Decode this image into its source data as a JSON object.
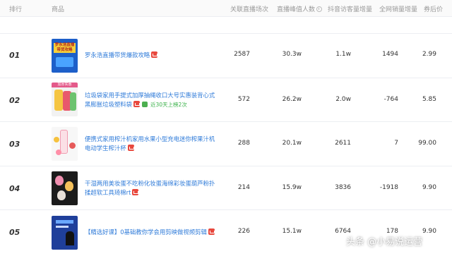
{
  "header": {
    "rank": "排行",
    "product": "商品",
    "live_count": "关联直播场次",
    "peak_viewers": "直播峰值人数",
    "visitor_growth": "抖音访客量增量",
    "sales_growth": "全网销量增量",
    "price_after_coupon": "券后价"
  },
  "rows": [
    {
      "rank": "01",
      "title": "罗永浩直播带货爆款攻略",
      "tag": "",
      "live_count": "2587",
      "peak_viewers": "30.3w",
      "visitor_growth": "1.1w",
      "sales_growth": "1494",
      "price": "2.99"
    },
    {
      "rank": "02",
      "title": "垃圾袋家用手提式加厚抽绳收口大号实惠装背心式黑膨胀垃圾塑料袋",
      "tag": "近30天上榜2次",
      "live_count": "572",
      "peak_viewers": "26.2w",
      "visitor_growth": "2.0w",
      "sales_growth": "-764",
      "price": "5.85"
    },
    {
      "rank": "03",
      "title": "便携式家用榨汁机家用水果小型充电迷你榨果汁机电动学生榨汁杯",
      "tag": "",
      "live_count": "288",
      "peak_viewers": "20.1w",
      "visitor_growth": "2611",
      "sales_growth": "7",
      "price": "99.00"
    },
    {
      "rank": "04",
      "title": "干湿两用美妆蛋不吃粉化妆蛋海绵彩妆蛋葫芦粉扑揉超软工具琦棉rt",
      "tag": "",
      "live_count": "214",
      "peak_viewers": "15.9w",
      "visitor_growth": "3836",
      "sales_growth": "-1918",
      "price": "9.90"
    },
    {
      "rank": "05",
      "title": "【精选好课】0基础教你学会用剪映做视频剪辑",
      "tag": "",
      "live_count": "226",
      "peak_viewers": "15.1w",
      "visitor_growth": "6764",
      "sales_growth": "178",
      "price": "9.90"
    }
  ],
  "thumbs": [
    {
      "icon": "course-cover-image",
      "text": "罗永浩直播带货攻略",
      "color": "#1d5fc9"
    },
    {
      "icon": "trash-bag-image",
      "text": "加厚实惠",
      "color": "#f2f2f2"
    },
    {
      "icon": "juicer-image",
      "text": "",
      "color": "#f7f7f7"
    },
    {
      "icon": "makeup-sponge-image",
      "text": "",
      "color": "#1b1b1b"
    },
    {
      "icon": "video-course-image",
      "text": "",
      "color": "#1f3f9a"
    }
  ],
  "watermark": "头条 @小易说运营",
  "colors": {
    "link": "#2f7bd9",
    "badge": "#e8483d",
    "tag": "#3bb24a"
  }
}
